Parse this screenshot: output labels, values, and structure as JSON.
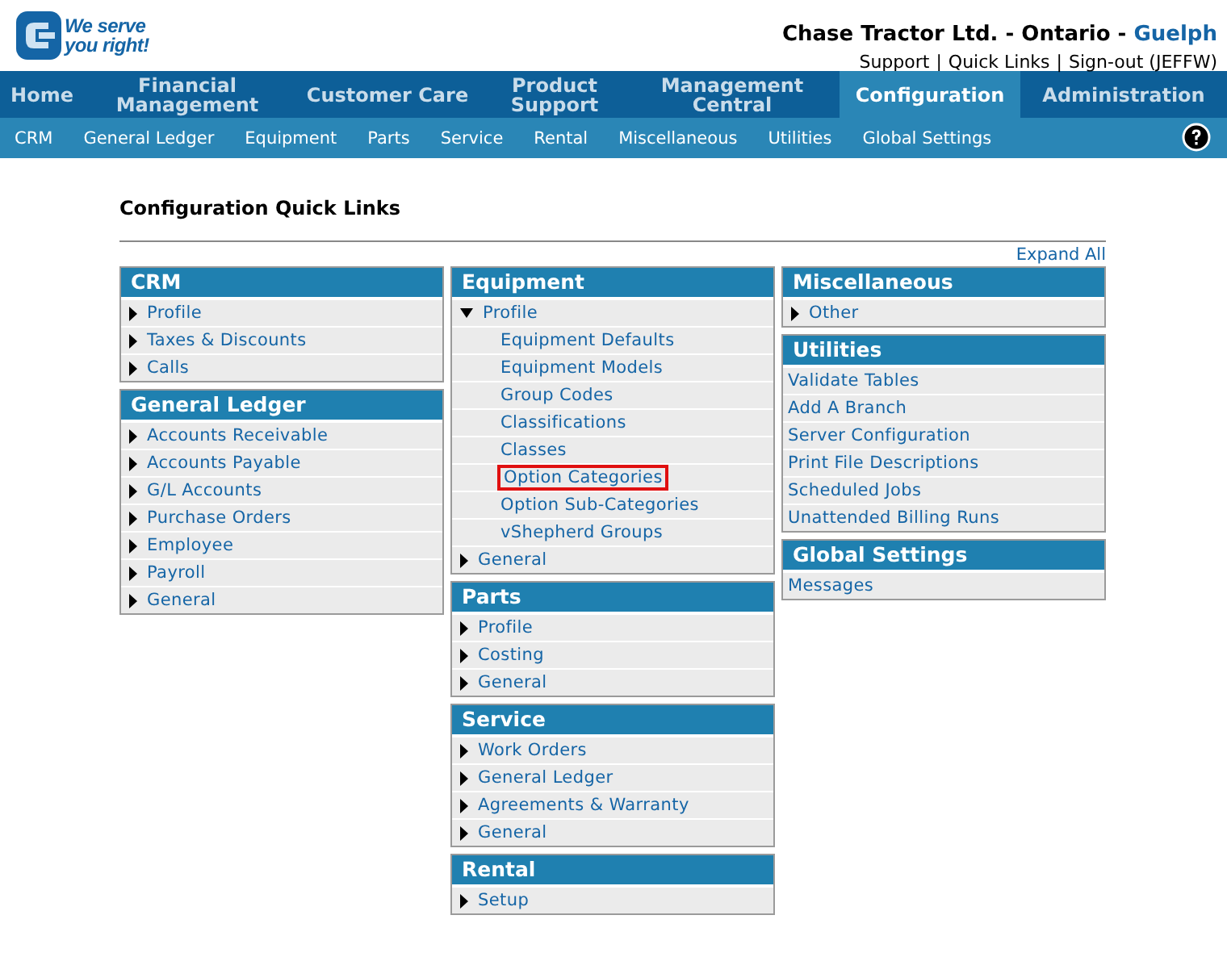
{
  "header": {
    "logo_tagline": "We serve you right!",
    "company": "Chase Tractor Ltd. - Ontario - ",
    "branch": "Guelph",
    "links": [
      "Support",
      "Quick Links",
      "Sign-out (JEFFW)"
    ],
    "link_separator": "|"
  },
  "main_nav": [
    {
      "label": "Home",
      "selected": false
    },
    {
      "label": "Financial Management",
      "selected": false
    },
    {
      "label": "Customer Care",
      "selected": false
    },
    {
      "label": "Product Support",
      "selected": false
    },
    {
      "label": "Management Central",
      "selected": false
    },
    {
      "label": "Configuration",
      "selected": true
    },
    {
      "label": "Administration",
      "selected": false
    }
  ],
  "sub_nav": [
    "CRM",
    "General Ledger",
    "Equipment",
    "Parts",
    "Service",
    "Rental",
    "Miscellaneous",
    "Utilities",
    "Global Settings"
  ],
  "page_title": "Configuration Quick Links",
  "expand_all": "Expand All",
  "columns": [
    [
      {
        "title": "CRM",
        "items": [
          {
            "kind": "group",
            "label": "Profile",
            "expanded": false
          },
          {
            "kind": "group",
            "label": "Taxes & Discounts",
            "expanded": false
          },
          {
            "kind": "group",
            "label": "Calls",
            "expanded": false
          }
        ]
      },
      {
        "title": "General Ledger",
        "items": [
          {
            "kind": "group",
            "label": "Accounts Receivable",
            "expanded": false
          },
          {
            "kind": "group",
            "label": "Accounts Payable",
            "expanded": false
          },
          {
            "kind": "group",
            "label": "G/L Accounts",
            "expanded": false
          },
          {
            "kind": "group",
            "label": "Purchase Orders",
            "expanded": false
          },
          {
            "kind": "group",
            "label": "Employee",
            "expanded": false
          },
          {
            "kind": "group",
            "label": "Payroll",
            "expanded": false
          },
          {
            "kind": "group",
            "label": "General",
            "expanded": false
          }
        ]
      }
    ],
    [
      {
        "title": "Equipment",
        "items": [
          {
            "kind": "group",
            "label": "Profile",
            "expanded": true,
            "children": [
              {
                "label": "Equipment Defaults",
                "highlighted": false
              },
              {
                "label": "Equipment Models",
                "highlighted": false
              },
              {
                "label": "Group Codes",
                "highlighted": false
              },
              {
                "label": "Classifications",
                "highlighted": false
              },
              {
                "label": "Classes",
                "highlighted": false
              },
              {
                "label": "Option Categories",
                "highlighted": true
              },
              {
                "label": "Option Sub-Categories",
                "highlighted": false
              },
              {
                "label": "vShepherd Groups",
                "highlighted": false
              }
            ]
          },
          {
            "kind": "group",
            "label": "General",
            "expanded": false
          }
        ]
      },
      {
        "title": "Parts",
        "items": [
          {
            "kind": "group",
            "label": "Profile",
            "expanded": false
          },
          {
            "kind": "group",
            "label": "Costing",
            "expanded": false
          },
          {
            "kind": "group",
            "label": "General",
            "expanded": false
          }
        ]
      },
      {
        "title": "Service",
        "items": [
          {
            "kind": "group",
            "label": "Work Orders",
            "expanded": false
          },
          {
            "kind": "group",
            "label": "General Ledger",
            "expanded": false
          },
          {
            "kind": "group",
            "label": "Agreements & Warranty",
            "expanded": false
          },
          {
            "kind": "group",
            "label": "General",
            "expanded": false
          }
        ]
      },
      {
        "title": "Rental",
        "items": [
          {
            "kind": "group",
            "label": "Setup",
            "expanded": false
          }
        ]
      }
    ],
    [
      {
        "title": "Miscellaneous",
        "items": [
          {
            "kind": "group",
            "label": "Other",
            "expanded": false
          }
        ]
      },
      {
        "title": "Utilities",
        "items": [
          {
            "kind": "link",
            "label": "Validate Tables"
          },
          {
            "kind": "link",
            "label": "Add A Branch"
          },
          {
            "kind": "link",
            "label": "Server Configuration"
          },
          {
            "kind": "link",
            "label": "Print File Descriptions"
          },
          {
            "kind": "link",
            "label": "Scheduled Jobs"
          },
          {
            "kind": "link",
            "label": "Unattended Billing Runs"
          }
        ]
      },
      {
        "title": "Global Settings",
        "items": [
          {
            "kind": "link",
            "label": "Messages"
          }
        ]
      }
    ]
  ]
}
